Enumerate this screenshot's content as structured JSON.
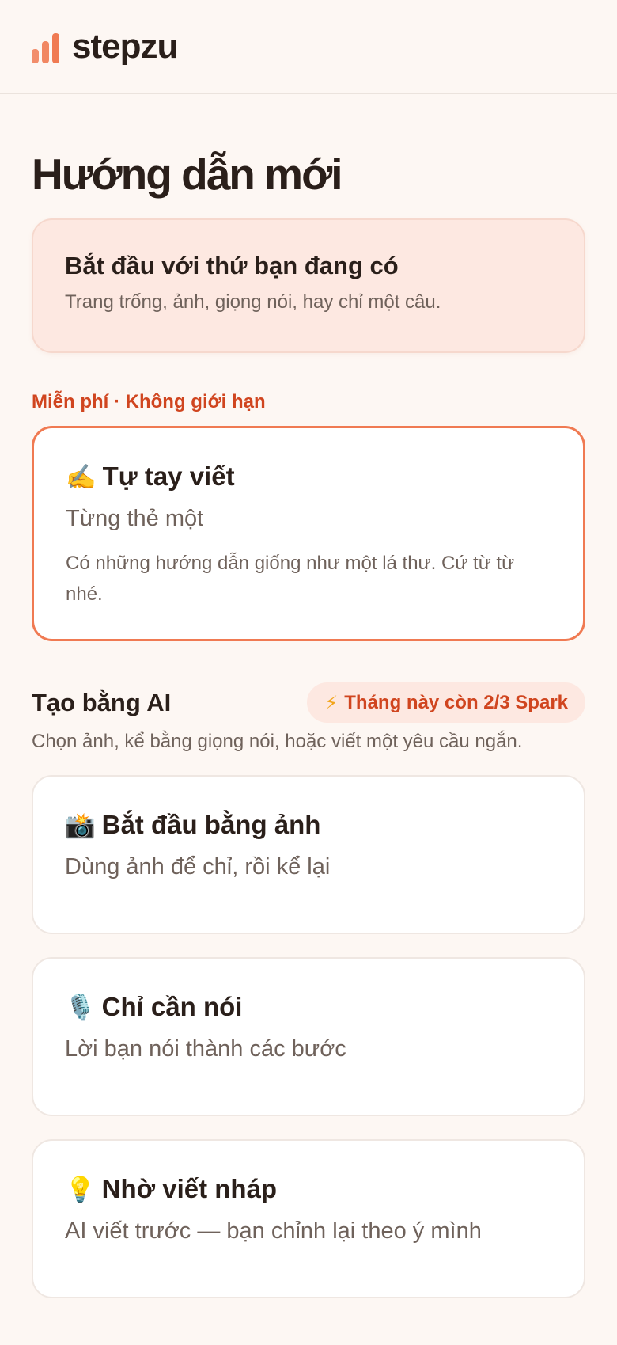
{
  "header": {
    "brand": "stepzu",
    "logo_icon": "bar-chart-logo-icon",
    "accent": "#f07a52"
  },
  "page": {
    "title": "Hướng dẫn mới"
  },
  "intro": {
    "title": "Bắt đầu với thứ bạn đang có",
    "subtitle": "Trang trống, ảnh, giọng nói, hay chỉ một câu."
  },
  "free_section": {
    "label": "Miễn phí · Không giới hạn",
    "manual_card": {
      "emoji": "✍️",
      "icon": "writing-hand-icon",
      "title": "Tự tay viết",
      "subtitle": "Từng thẻ một",
      "description": "Có những hướng dẫn giống như một lá thư. Cứ từ từ nhé."
    }
  },
  "ai_section": {
    "title": "Tạo bằng AI",
    "badge_icon": "⚡",
    "badge_text": "Tháng này còn 2/3 Spark",
    "subtitle": "Chọn ảnh, kể bằng giọng nói, hoặc viết một yêu cầu ngắn.",
    "cards": [
      {
        "emoji": "📸",
        "icon": "camera-flash-icon",
        "title": "Bắt đầu bằng ảnh",
        "subtitle": "Dùng ảnh để chỉ, rồi kể lại"
      },
      {
        "emoji": "🎙️",
        "icon": "microphone-icon",
        "title": "Chỉ cần nói",
        "subtitle": "Lời bạn nói thành các bước"
      },
      {
        "emoji": "💡",
        "icon": "lightbulb-icon",
        "title": "Nhờ viết nháp",
        "subtitle": "AI viết trước — bạn chỉnh lại theo ý mình"
      }
    ]
  }
}
